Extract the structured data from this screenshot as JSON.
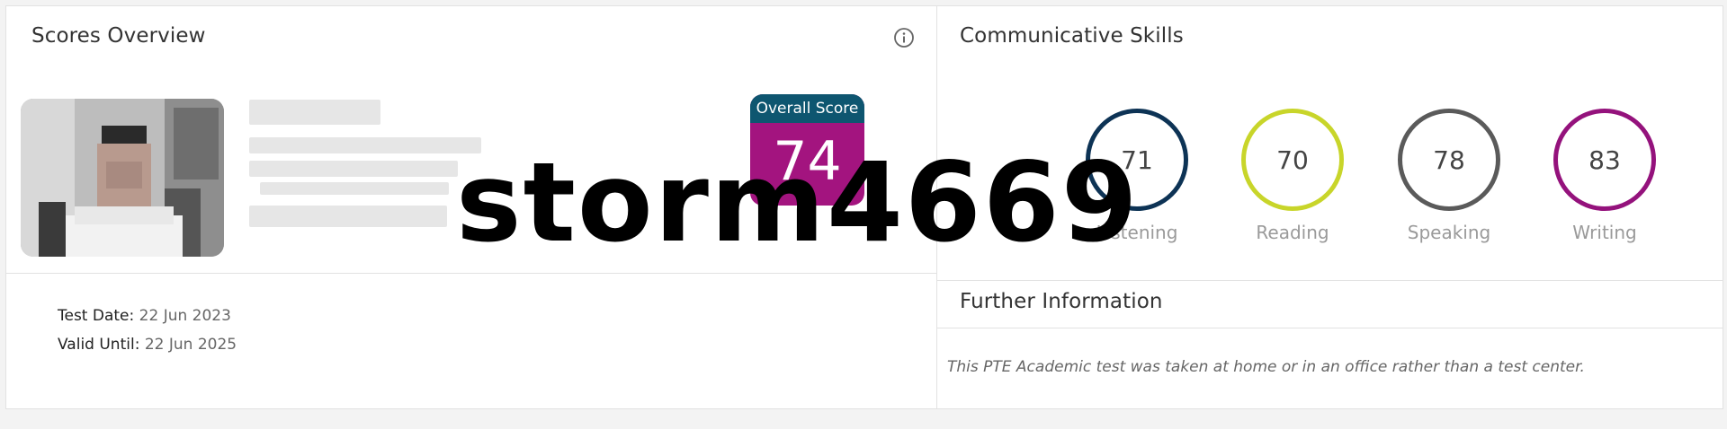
{
  "scores_overview": {
    "title": "Scores Overview",
    "overall_score_label": "Overall Score",
    "overall_score": "74",
    "overall_score_color": "#a3147f",
    "overall_header_color": "#0e5670",
    "test_date_label": "Test Date",
    "test_date": "22 Jun 2023",
    "valid_until_label": "Valid Until",
    "valid_until": "22 Jun 2025"
  },
  "communicative_skills": {
    "title": "Communicative Skills",
    "skills": [
      {
        "label": "Listening",
        "score": "71",
        "color": "#0d3355"
      },
      {
        "label": "Reading",
        "score": "70",
        "color": "#c8d52a"
      },
      {
        "label": "Speaking",
        "score": "78",
        "color": "#5a5a5a"
      },
      {
        "label": "Writing",
        "score": "83",
        "color": "#94127c"
      }
    ]
  },
  "further_information": {
    "title": "Further Information",
    "note": "This PTE Academic test was taken at home or in an office rather than a test center."
  },
  "watermark": "storm4669"
}
